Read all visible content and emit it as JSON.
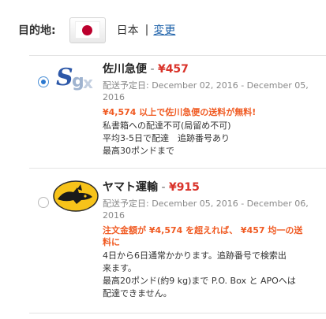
{
  "destination": {
    "label": "目的地:",
    "flag_icon": "japan-flag-icon",
    "country": "日本",
    "separator": "|",
    "change_link": "変更"
  },
  "shipping_options": [
    {
      "logo_icon": "sagawa-logo-icon",
      "name": "佐川急便",
      "dash": " - ",
      "price": "¥457",
      "selected": true,
      "date_line_1": "配送予定日: December 02, 2016 - December 05,",
      "date_line_2": "2016",
      "promo": "¥4,574 以上で佐川急便の送料が無料!",
      "notes": [
        "私書箱への配達不可(局留め不可)",
        "平均3-5日で配達　追跡番号あり",
        "最高30ポンドまで"
      ]
    },
    {
      "logo_icon": "yamato-logo-icon",
      "name": "ヤマト運輸",
      "dash": " - ",
      "price": "¥915",
      "selected": false,
      "date_line_1": "配送予定日: December 05, 2016 - December 06,",
      "date_line_2": "2016",
      "promo_line_1": "注文金額が ¥4,574 を超えれば、 ¥457 均一の送",
      "promo_line_2": "料に",
      "notes": [
        "4日から6日通常かかります。追跡番号で検索出",
        "来ます。",
        "最高20ポンド(約9 kg)まで P.O. Box と APOへは",
        "配達できません。"
      ]
    }
  ],
  "colors": {
    "price": "#d9332a",
    "promo": "#f05a22",
    "link": "#1a5fa8",
    "date": "#888888",
    "radio_selected": "#2b78cf"
  }
}
